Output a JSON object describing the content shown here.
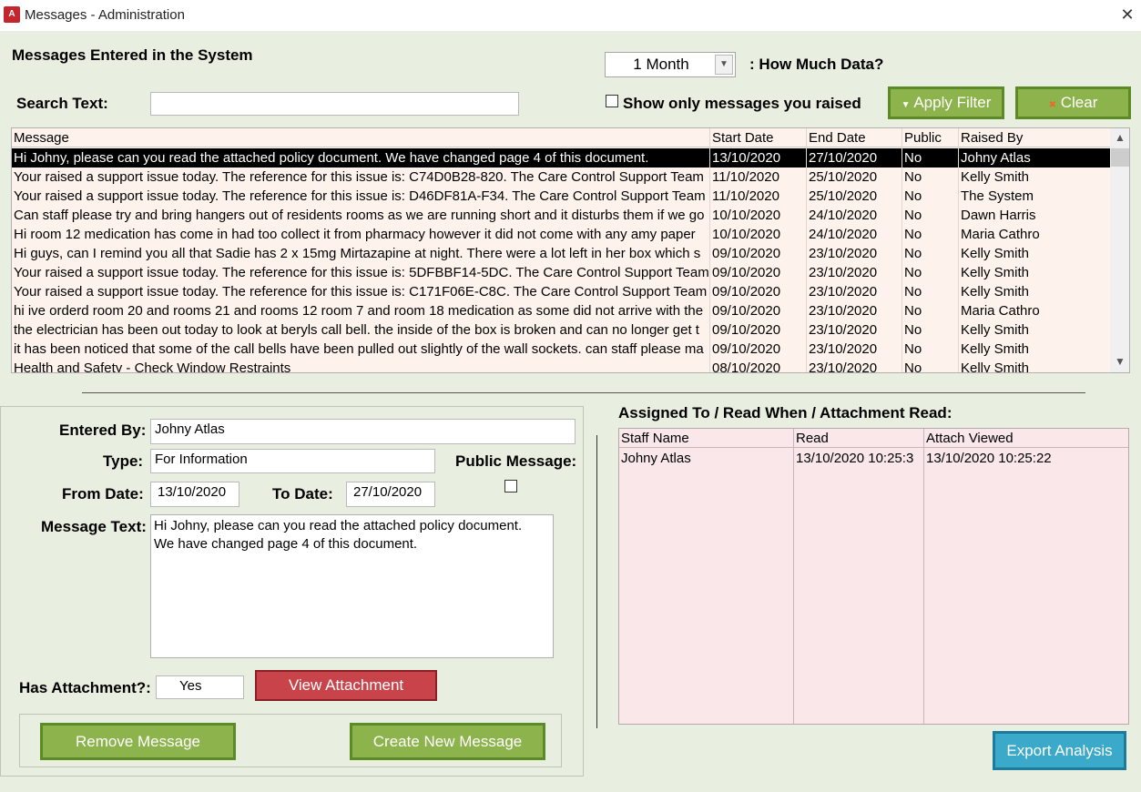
{
  "window": {
    "title": "Messages - Administration",
    "app_icon_label": "A",
    "close_icon": "close-icon"
  },
  "header": {
    "heading": "Messages Entered in the System",
    "search_label": "Search Text:",
    "search_value": "",
    "period_value": "1 Month",
    "period_label": ": How Much Data?",
    "show_only_label": "Show only messages you raised",
    "show_only_checked": false,
    "apply_filter_label": "Apply Filter",
    "clear_label": "Clear"
  },
  "grid": {
    "columns": [
      "Message",
      "Start Date",
      "End Date",
      "Public",
      "Raised By"
    ],
    "selected_index": 0,
    "rows": [
      [
        "Hi Johny, please can you read the attached policy document.  We have changed page 4 of this document.",
        "13/10/2020",
        "27/10/2020",
        "No",
        "Johny Atlas"
      ],
      [
        "Your raised a support issue today.  The reference for this issue is: C74D0B28-820. The Care Control Support Team",
        "11/10/2020",
        "25/10/2020",
        "No",
        "Kelly Smith"
      ],
      [
        "Your raised a support issue today.  The reference for this issue is: D46DF81A-F34. The Care Control Support Team",
        "11/10/2020",
        "25/10/2020",
        "No",
        "The System"
      ],
      [
        "Can staff please try and bring hangers out of residents rooms as we are running short and it disturbs them if we go",
        "10/10/2020",
        "24/10/2020",
        "No",
        "Dawn Harris"
      ],
      [
        "Hi room 12 medication has come in had too collect it from pharmacy however it did not come with any amy paper",
        "10/10/2020",
        "24/10/2020",
        "No",
        "Maria Cathro"
      ],
      [
        "Hi guys, can I remind you all that Sadie has 2 x 15mg  Mirtazapine at night.  There were a lot left in her box which s",
        "09/10/2020",
        "23/10/2020",
        "No",
        "Kelly Smith"
      ],
      [
        "Your raised a support issue today.  The reference for this issue is: 5DFBBF14-5DC. The Care Control Support Team",
        "09/10/2020",
        "23/10/2020",
        "No",
        "Kelly Smith"
      ],
      [
        "Your raised a support issue today.  The reference for this issue is: C171F06E-C8C. The Care Control Support Team v",
        "09/10/2020",
        "23/10/2020",
        "No",
        "Kelly Smith"
      ],
      [
        "hi ive orderd room 20 and rooms 21 and rooms 12 room 7 and room 18 medication as some did not arrive with the",
        "09/10/2020",
        "23/10/2020",
        "No",
        "Maria Cathro"
      ],
      [
        "the electrician has been out today to look at beryls call bell.  the inside of the box is broken and can no longer get t",
        "09/10/2020",
        "23/10/2020",
        "No",
        "Kelly Smith"
      ],
      [
        "it has been noticed that some of the call bells have been pulled out slightly of the wall sockets.  can staff please ma",
        "09/10/2020",
        "23/10/2020",
        "No",
        "Kelly Smith"
      ],
      [
        "Health and Safety - Check Window Restraints",
        "08/10/2020",
        "23/10/2020",
        "No",
        "Kelly Smith"
      ]
    ]
  },
  "detail": {
    "entered_by_label": "Entered By:",
    "entered_by_value": "Johny Atlas",
    "type_label": "Type:",
    "type_value": "For Information",
    "public_label": "Public Message:",
    "public_checked": false,
    "from_label": "From Date:",
    "from_value": "13/10/2020",
    "to_label": "To Date:",
    "to_value": "27/10/2020",
    "message_label": "Message Text:",
    "message_line1": "Hi Johny, please can you read the attached policy document.",
    "message_line2": "We have changed page 4 of this document.",
    "attachment_label": "Has Attachment?:",
    "attachment_value": "Yes",
    "view_attachment_label": "View Attachment",
    "remove_label": "Remove Message",
    "create_label": "Create New Message"
  },
  "assigned": {
    "heading": "Assigned To / Read When / Attachment Read:",
    "columns": [
      "Staff Name",
      "Read",
      "Attach Viewed"
    ],
    "rows": [
      [
        "Johny Atlas",
        "13/10/2020 10:25:3",
        "13/10/2020 10:25:22"
      ]
    ],
    "export_label": "Export Analysis"
  },
  "colors": {
    "background": "#e8efe0",
    "green_button": "#8db34c",
    "red_button": "#c9444a",
    "blue_button": "#3ba9c9",
    "grid_row": "#fdf3ec",
    "assign_bg": "#f9e7e9"
  }
}
